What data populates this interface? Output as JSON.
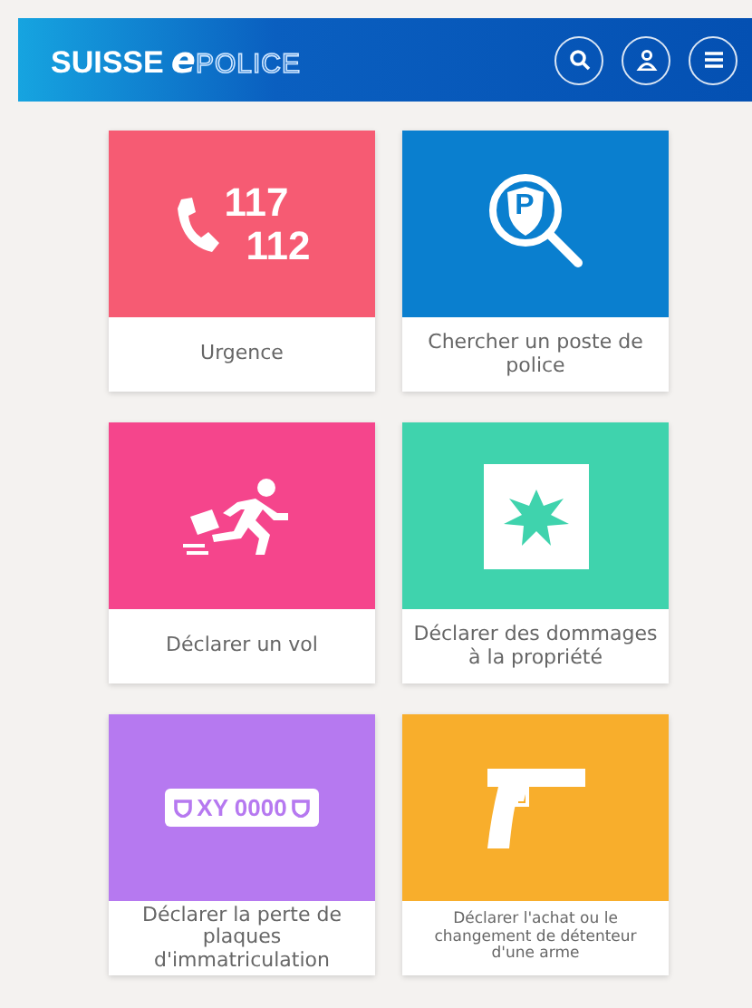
{
  "header": {
    "logo": {
      "brand": "SUISSE",
      "letter": "e",
      "word": "POLICE"
    }
  },
  "tiles": [
    {
      "kind": "emergency",
      "color": "#f65b73",
      "label": "Urgence",
      "numbers": [
        "117",
        "112"
      ]
    },
    {
      "kind": "station",
      "color": "#0a7fcf",
      "label": "Chercher un poste de police",
      "badge": "P"
    },
    {
      "kind": "theft",
      "color": "#f5458c",
      "label": "Déclarer un vol"
    },
    {
      "kind": "damage",
      "color": "#3fd3ad",
      "label": "Déclarer des dommages à la propriété"
    },
    {
      "kind": "plate",
      "color": "#b679f0",
      "label": "Déclarer la perte de plaques d'immatriculation",
      "plate": "XY 0000"
    },
    {
      "kind": "weapon",
      "color": "#f8ae2c",
      "label": "Déclarer l'achat ou le changement de détenteur d'une arme",
      "small": true
    }
  ]
}
